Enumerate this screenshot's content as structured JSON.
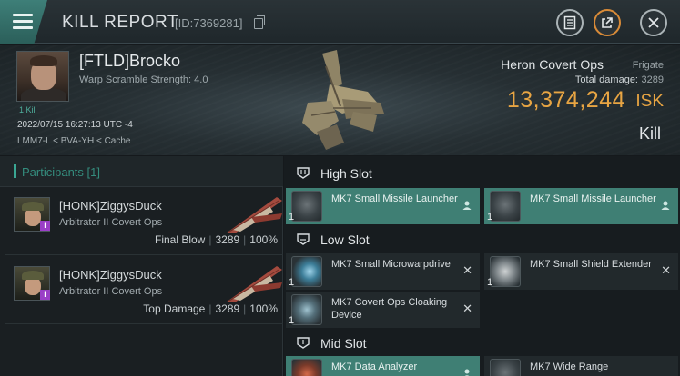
{
  "header": {
    "title": "KILL REPORT",
    "report_id": "[ID:7369281]",
    "buttons": [
      "document-icon",
      "share-icon",
      "close-icon"
    ]
  },
  "victim": {
    "name": "[FTLD]Brocko",
    "warp_scramble": "Warp Scramble Strength: 4.0",
    "kill_count": "1 Kill",
    "datetime": "2022/07/15 16:27:13 UTC -4",
    "location": "LMM7-L < BVA-YH < Cache",
    "ship_name": "Heron Covert Ops",
    "ship_class": "Frigate",
    "total_damage_label": "Total damage:",
    "total_damage_value": "3289",
    "isk_value": "13,374,244",
    "isk_unit": "ISK",
    "outcome": "Kill"
  },
  "participants": {
    "header": "Participants [1]",
    "rows": [
      {
        "name": "[HONK]ZiggysDuck",
        "ship": "Arbitrator II Covert Ops",
        "tag": "Final Blow",
        "damage": "3289",
        "percent": "100%"
      },
      {
        "name": "[HONK]ZiggysDuck",
        "ship": "Arbitrator II Covert Ops",
        "tag": "Top Damage",
        "damage": "3289",
        "percent": "100%"
      }
    ]
  },
  "fittings": {
    "high_slot": {
      "label": "High Slot",
      "modules": [
        {
          "name": "MK7 Small Missile Launcher",
          "qty": "1",
          "status": "person-icon"
        },
        {
          "name": "MK7 Small Missile Launcher",
          "qty": "1",
          "status": "person-icon"
        }
      ]
    },
    "low_slot": {
      "label": "Low Slot",
      "modules": [
        {
          "name": "MK7 Small Microwarpdrive",
          "qty": "1",
          "status": "x"
        },
        {
          "name": "MK7 Small Shield Extender",
          "qty": "1",
          "status": "x"
        },
        {
          "name": "MK7 Covert Ops Cloaking Device",
          "qty": "1",
          "status": "x"
        }
      ]
    },
    "mid_slot": {
      "label": "Mid Slot",
      "modules": [
        {
          "name": "MK7 Data Analyzer",
          "qty": "",
          "status": "person-icon"
        },
        {
          "name": "MK7 Wide Range",
          "qty": "",
          "status": ""
        }
      ]
    }
  },
  "colors": {
    "accent_teal": "#3aa693",
    "highlight_row": "#3f7f74",
    "isk_orange": "#e8a543",
    "info_purple": "#9a3fc7"
  }
}
